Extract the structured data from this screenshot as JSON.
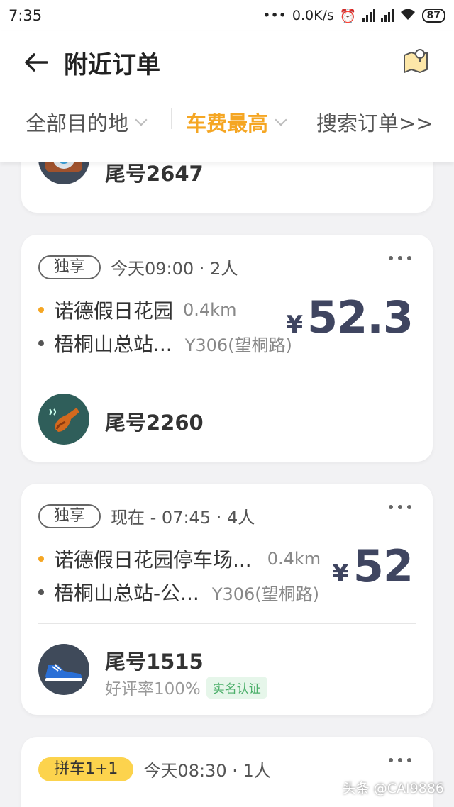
{
  "status_bar": {
    "time": "7:35",
    "speed": "0.0K/s",
    "battery": "87"
  },
  "header": {
    "title": "附近订单"
  },
  "filters": {
    "destination": "全部目的地",
    "sort": "车费最高",
    "search": "搜索订单>>"
  },
  "orders": [
    {
      "user": "尾号2647"
    },
    {
      "tag": "独享",
      "time": "今天09:00 · 2人",
      "from": "诺德假日花园",
      "from_dist": "0.4km",
      "to": "梧桐山总站...",
      "to_sub": "Y306(望桐路)",
      "currency": "¥",
      "price": "52.3",
      "user": "尾号2260"
    },
    {
      "tag": "独享",
      "time": "现在 - 07:45 · 4人",
      "from": "诺德假日花园停车场...",
      "from_dist": "0.4km",
      "to": "梧桐山总站-公...",
      "to_sub": "Y306(望桐路)",
      "currency": "¥",
      "price": "52",
      "user": "尾号1515",
      "rating": "好评率100%",
      "badge": "实名认证"
    },
    {
      "tag": "拼车1+1",
      "time": "今天08:30 · 1人"
    }
  ],
  "watermark": "头条 @CAI9886",
  "colors": {
    "accent": "#f5a623",
    "price": "#3f4560",
    "verified": "#4caf6a"
  }
}
